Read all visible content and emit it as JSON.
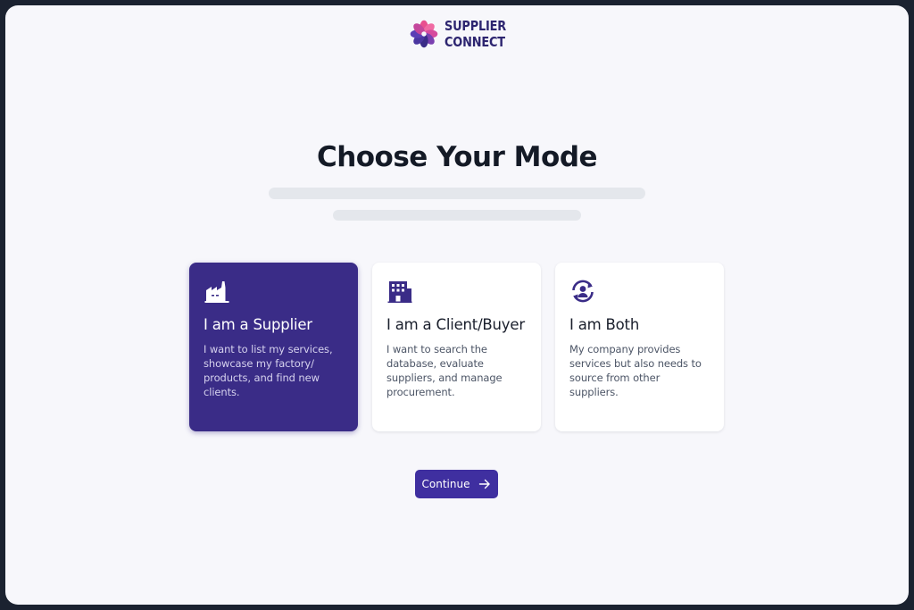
{
  "brand": {
    "line1": "SUPPLIER",
    "line2": "CONNECT",
    "icon": "flower-logo-icon",
    "colors": {
      "pink": "#e8508f",
      "purple": "#3a2c87"
    }
  },
  "main": {
    "title": "Choose Your Mode"
  },
  "modes": [
    {
      "icon": "factory-icon",
      "title": "I am a Supplier",
      "description": "I want to list my services, showcase my factory/ products, and find new clients.",
      "selected": true
    },
    {
      "icon": "building-icon",
      "title": "I am a Client/Buyer",
      "description": "I want to search the database, evaluate suppliers, and manage procurement.",
      "selected": false
    },
    {
      "icon": "sync-user-icon",
      "title": "I am Both",
      "description": "My company provides services but also needs to source from other suppliers.",
      "selected": false
    }
  ],
  "actions": {
    "continue_label": "Continue",
    "continue_icon": "arrow-right-icon"
  },
  "theme": {
    "accent": "#3f2fa0",
    "selected_card": "#3a2c87",
    "background": "#f7f7fb"
  }
}
